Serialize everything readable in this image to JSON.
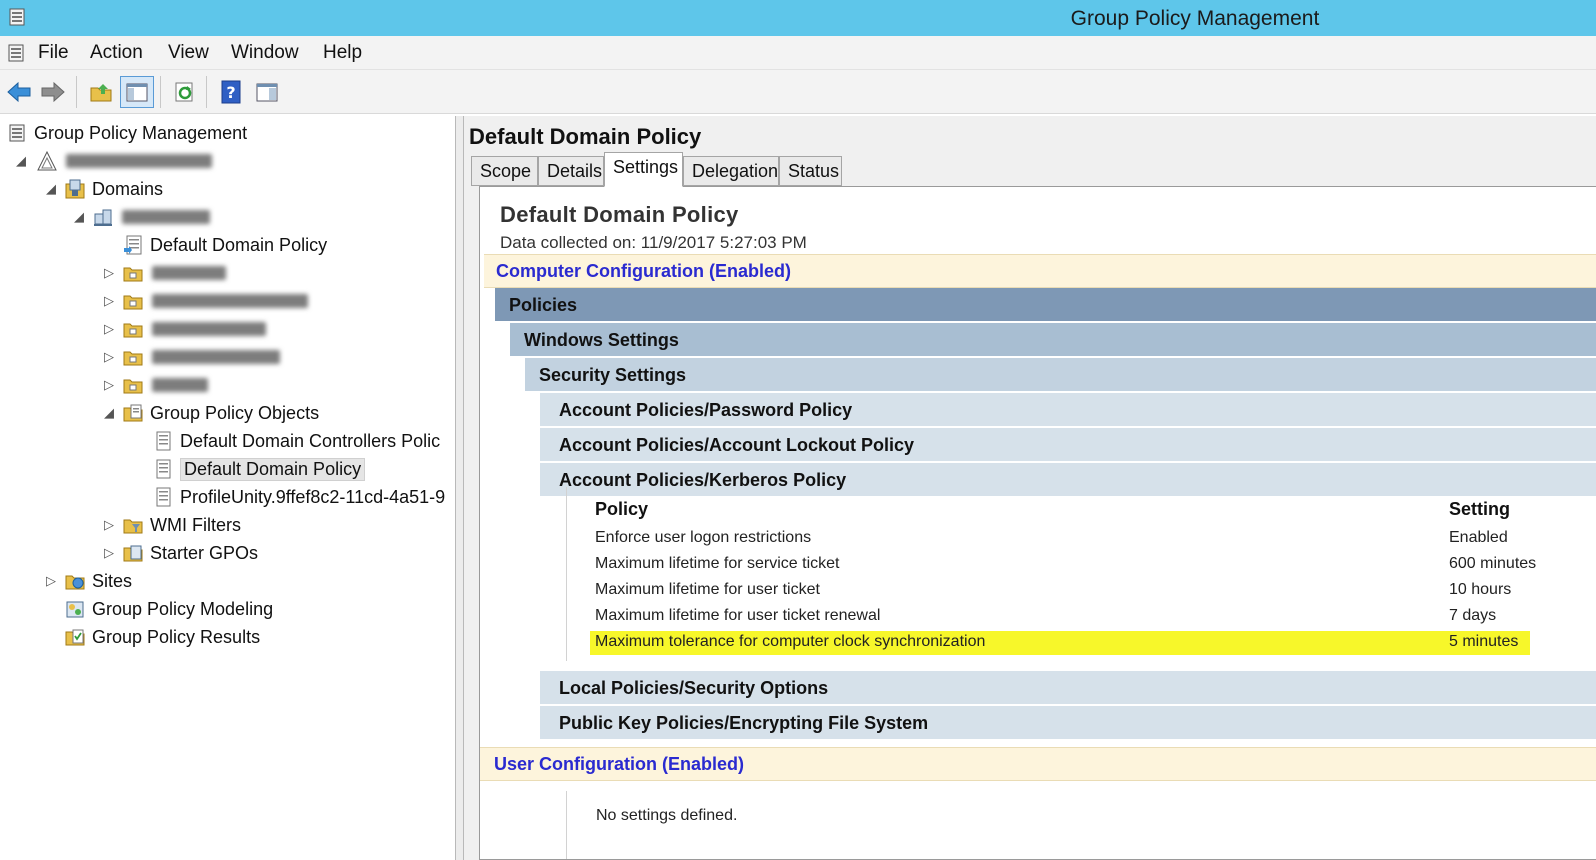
{
  "window": {
    "title": "Group Policy Management",
    "app_icon": "gpmc-app-icon"
  },
  "menu": {
    "items": [
      {
        "label": "File"
      },
      {
        "label": "Action"
      },
      {
        "label": "View"
      },
      {
        "label": "Window"
      },
      {
        "label": "Help"
      }
    ]
  },
  "toolbar": {
    "buttons": [
      "back-arrow-icon",
      "forward-arrow-icon",
      "folder-up-icon",
      "show-hide-tree-icon",
      "refresh-icon",
      "help-icon",
      "properties-pane-icon"
    ]
  },
  "tree": {
    "root": "Group Policy Management",
    "forest": "[redacted]",
    "domains": "Domains",
    "domain": "[redacted]",
    "default_domain_policy": "Default Domain Policy",
    "ous": [
      "[redacted]",
      "[redacted]",
      "[redacted]",
      "[redacted]",
      "[redacted]"
    ],
    "gpo_container": "Group Policy Objects",
    "gpos": [
      "Default Domain Controllers Polic",
      "Default Domain Policy",
      "ProfileUnity.9ffef8c2-11cd-4a51-9"
    ],
    "wmi_filters": "WMI Filters",
    "starter_gpos": "Starter GPOs",
    "sites": "Sites",
    "modeling": "Group Policy Modeling",
    "results": "Group Policy Results"
  },
  "right": {
    "title": "Default Domain Policy",
    "tabs": [
      "Scope",
      "Details",
      "Settings",
      "Delegation",
      "Status"
    ],
    "active_tab": "Settings"
  },
  "report": {
    "title": "Default Domain Policy",
    "collected": "Data collected on: 11/9/2017 5:27:03 PM",
    "computer_config": "Computer Configuration (Enabled)",
    "policies": "Policies",
    "windows_settings": "Windows Settings",
    "security_settings": "Security Settings",
    "sections": [
      "Account Policies/Password Policy",
      "Account Policies/Account Lockout Policy",
      "Account Policies/Kerberos Policy"
    ],
    "kerberos_table": {
      "header": {
        "policy": "Policy",
        "setting": "Setting"
      },
      "rows": [
        {
          "policy": "Enforce user logon restrictions",
          "setting": "Enabled"
        },
        {
          "policy": "Maximum lifetime for service ticket",
          "setting": "600 minutes"
        },
        {
          "policy": "Maximum lifetime for user ticket",
          "setting": "10 hours"
        },
        {
          "policy": "Maximum lifetime for user ticket renewal",
          "setting": "7 days"
        },
        {
          "policy": "Maximum tolerance for computer clock synchronization",
          "setting": "5 minutes"
        }
      ],
      "highlight_color": "#f7f72a"
    },
    "more_sections": [
      "Local Policies/Security Options",
      "Public Key Policies/Encrypting File System"
    ],
    "user_config": "User Configuration (Enabled)",
    "no_settings": "No settings defined."
  },
  "colors": {
    "titlebar": "#5ec6ea",
    "config_band": "#fdf4dc",
    "config_text": "#2a2ad0"
  }
}
